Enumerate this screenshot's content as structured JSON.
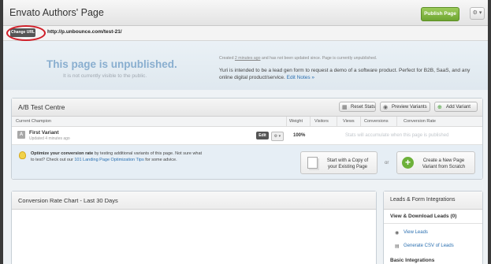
{
  "header": {
    "title": "Envato Authors' Page",
    "publish_label": "Publish Page",
    "gear_label": "⚙ ▾"
  },
  "urlbar": {
    "change_url_label": "Change URL",
    "url": "http://p.unbounce.com/test-21/"
  },
  "banner": {
    "title": "This page is unpublished.",
    "subtitle": "It is not currently visible to the public.",
    "created_prefix": "Created",
    "created_when": "2 minutes ago",
    "created_suffix": "and has not been updated since. Page is currently unpublished.",
    "description": "Yuri is intended to be a lead gen form to request a demo of a software product. Perfect for B2B, SaaS, and any online digital product/service.",
    "edit_notes": "Edit Notes »"
  },
  "ab_test": {
    "title": "A/B Test Centre",
    "buttons": {
      "reset": "Reset Stats",
      "preview": "Preview Variants",
      "add": "Add Variant"
    },
    "columns": {
      "champion": "Current Champion",
      "weight": "Weight",
      "visitors": "Visitors",
      "views": "Views",
      "conversions": "Conversions",
      "conversion_rate": "Conversion Rate"
    },
    "variant": {
      "letter": "A",
      "name": "First Variant",
      "updated": "Updated 4 minutes ago",
      "edit_label": "Edit",
      "menu_label": "⚙ ▾",
      "weight": "100%",
      "stats_message": "Stats will accumulate when this page is published"
    },
    "tip": {
      "bold": "Optimize your conversion rate",
      "text": "by testing additional variants of this page. Not sure what to test? Check out our",
      "link": "101 Landing Page Optimization Tips",
      "suffix": "for some advice."
    },
    "copy_label_1": "Start with a Copy of",
    "copy_label_2": "your Existing Page",
    "or_label": "or",
    "new_label_1": "Create a New Page",
    "new_label_2": "Variant from Scratch"
  },
  "chart_panel": {
    "title": "Conversion Rate Chart - Last 30 Days"
  },
  "leads": {
    "title": "Leads & Form Integrations",
    "view_download": "View & Download Leads (0)",
    "view_leads": "View Leads",
    "generate_csv": "Generate CSV of Leads",
    "basic_integrations": "Basic Integrations"
  }
}
